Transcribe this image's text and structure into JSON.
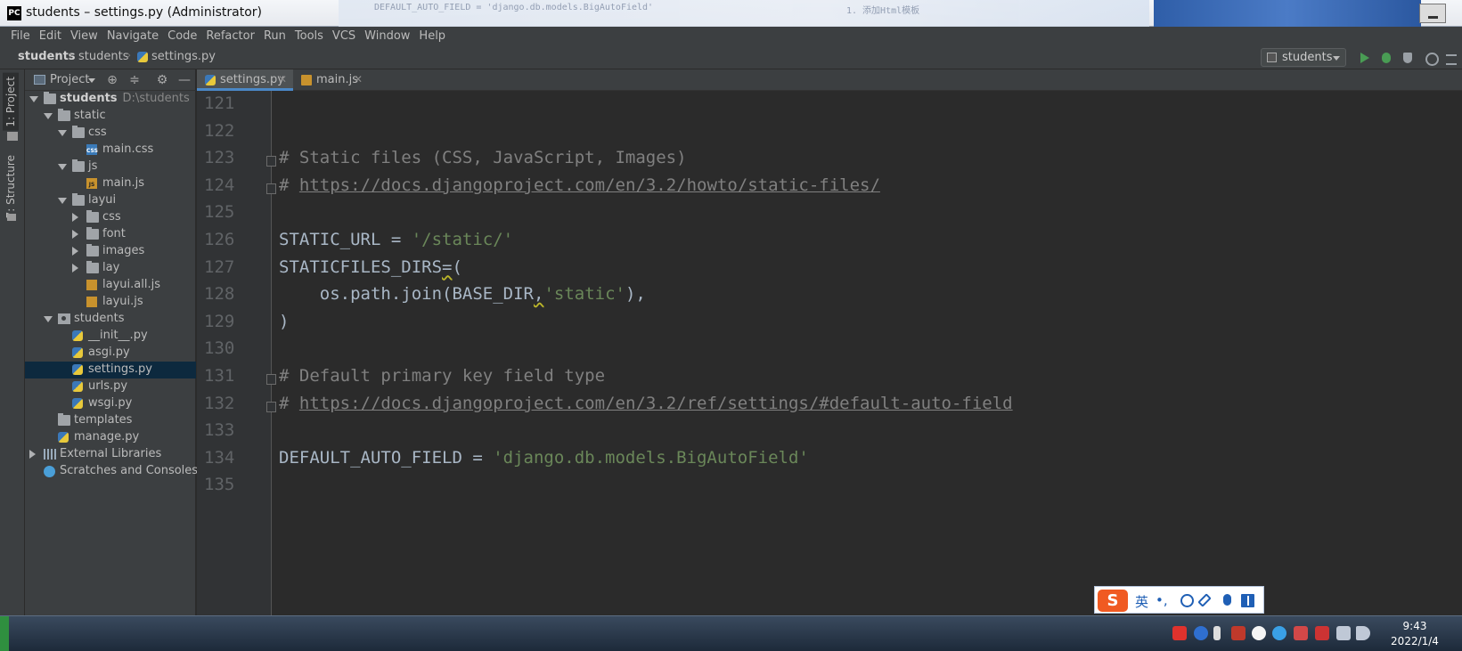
{
  "window": {
    "title": "students – settings.py (Administrator)",
    "app_icon": "PC",
    "background_text_1": "DEFAULT_AUTO_FIELD = 'django.db.models.BigAutoField'",
    "background_text_2": "1. 添加Html模板"
  },
  "menu": [
    "File",
    "Edit",
    "View",
    "Navigate",
    "Code",
    "Refactor",
    "Run",
    "Tools",
    "VCS",
    "Window",
    "Help"
  ],
  "breadcrumb": [
    "students",
    "students",
    "settings.py"
  ],
  "run_config": {
    "label": "students"
  },
  "side_tabs": [
    "1: Project",
    "7: Structure"
  ],
  "project_panel": {
    "title": "Project",
    "icons": [
      "locate-icon",
      "collapse-icon",
      "gear-icon",
      "minimize-icon"
    ]
  },
  "tree": [
    {
      "label": "students",
      "path": "D:\\students",
      "kind": "folder",
      "arrow": "down",
      "depth": 0,
      "bold": true
    },
    {
      "label": "static",
      "kind": "folder",
      "arrow": "down",
      "depth": 1
    },
    {
      "label": "css",
      "kind": "folder",
      "arrow": "down",
      "depth": 2
    },
    {
      "label": "main.css",
      "kind": "css",
      "depth": 3
    },
    {
      "label": "js",
      "kind": "folder",
      "arrow": "down",
      "depth": 2
    },
    {
      "label": "main.js",
      "kind": "js",
      "depth": 3
    },
    {
      "label": "layui",
      "kind": "folder",
      "arrow": "down",
      "depth": 2
    },
    {
      "label": "css",
      "kind": "folder",
      "arrow": "right",
      "depth": 3
    },
    {
      "label": "font",
      "kind": "folder",
      "arrow": "right",
      "depth": 3
    },
    {
      "label": "images",
      "kind": "folder",
      "arrow": "right",
      "depth": 3
    },
    {
      "label": "lay",
      "kind": "folder",
      "arrow": "right",
      "depth": 3
    },
    {
      "label": "layui.all.js",
      "kind": "bin",
      "depth": 3
    },
    {
      "label": "layui.js",
      "kind": "bin",
      "depth": 3
    },
    {
      "label": "students",
      "kind": "pkg",
      "arrow": "down",
      "depth": 1
    },
    {
      "label": "__init__.py",
      "kind": "py",
      "depth": 2
    },
    {
      "label": "asgi.py",
      "kind": "py",
      "depth": 2
    },
    {
      "label": "settings.py",
      "kind": "py",
      "depth": 2,
      "selected": true
    },
    {
      "label": "urls.py",
      "kind": "py",
      "depth": 2
    },
    {
      "label": "wsgi.py",
      "kind": "py",
      "depth": 2
    },
    {
      "label": "templates",
      "kind": "folder",
      "depth": 1
    },
    {
      "label": "manage.py",
      "kind": "py",
      "depth": 1
    },
    {
      "label": "External Libraries",
      "kind": "lib",
      "arrow": "right",
      "depth": 0
    },
    {
      "label": "Scratches and Consoles",
      "kind": "scratch",
      "depth": 0
    }
  ],
  "tabs": [
    {
      "label": "settings.py",
      "icon": "python-file-icon",
      "active": true
    },
    {
      "label": "main.js",
      "icon": "js-file-icon",
      "active": false
    }
  ],
  "editor": {
    "lines": [
      {
        "n": "121",
        "tokens": []
      },
      {
        "n": "122",
        "tokens": []
      },
      {
        "n": "123",
        "fold": true,
        "tokens": [
          {
            "t": "# Static files (CSS, JavaScript, Images)",
            "c": "cm"
          }
        ]
      },
      {
        "n": "124",
        "fold": true,
        "tokens": [
          {
            "t": "# ",
            "c": "cm"
          },
          {
            "t": "https://docs.djangoproject.com/en/3.2/howto/static-files/",
            "c": "url"
          }
        ]
      },
      {
        "n": "125",
        "tokens": []
      },
      {
        "n": "126",
        "tokens": [
          {
            "t": "STATIC_URL = ",
            "c": ""
          },
          {
            "t": "'/static/'",
            "c": "str"
          }
        ]
      },
      {
        "n": "127",
        "tokens": [
          {
            "t": "STATICFILES_DIRS",
            "c": ""
          },
          {
            "t": "=",
            "c": "warn"
          },
          {
            "t": "(",
            "c": ""
          }
        ]
      },
      {
        "n": "128",
        "tokens": [
          {
            "t": "    os.path.join(BASE_DIR",
            "c": ""
          },
          {
            "t": ",",
            "c": "warn"
          },
          {
            "t": "'static'",
            "c": "str"
          },
          {
            "t": "),",
            "c": ""
          }
        ]
      },
      {
        "n": "129",
        "tokens": [
          {
            "t": ")",
            "c": ""
          }
        ]
      },
      {
        "n": "130",
        "tokens": []
      },
      {
        "n": "131",
        "fold": true,
        "tokens": [
          {
            "t": "# Default primary key field type",
            "c": "cm"
          }
        ]
      },
      {
        "n": "132",
        "fold": true,
        "tokens": [
          {
            "t": "# ",
            "c": "cm"
          },
          {
            "t": "https://docs.djangoproject.com/en/3.2/ref/settings/#default-auto-field",
            "c": "url"
          }
        ]
      },
      {
        "n": "133",
        "tokens": []
      },
      {
        "n": "134",
        "tokens": [
          {
            "t": "DEFAULT_AUTO_FIELD = ",
            "c": ""
          },
          {
            "t": "'django.db.models.BigAutoField'",
            "c": "str"
          }
        ]
      },
      {
        "n": "135",
        "tokens": []
      }
    ]
  },
  "ime": {
    "logo": "S",
    "mode": "英",
    "punct": "•,"
  },
  "taskbar": {
    "time": "9:43",
    "date": "2022/1/4"
  },
  "colors": {
    "accent": "#4a88c7",
    "string": "#6a8759",
    "comment": "#808080",
    "selection": "#0d293e"
  }
}
